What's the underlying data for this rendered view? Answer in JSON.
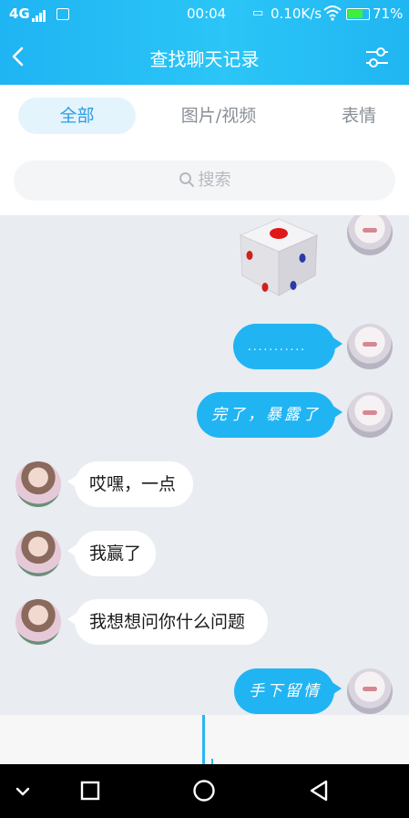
{
  "status_bar": {
    "network": "4G",
    "time": "00:04",
    "speed": "0.10K/s",
    "battery": "71%"
  },
  "header": {
    "title": "查找聊天记录"
  },
  "tabs": [
    {
      "label": "全部",
      "active": true
    },
    {
      "label": "图片/视频",
      "active": false
    },
    {
      "label": "表情",
      "active": false
    }
  ],
  "search": {
    "placeholder": "搜索"
  },
  "messages": [
    {
      "side": "out",
      "type": "dice"
    },
    {
      "side": "out",
      "type": "text",
      "text": "..........."
    },
    {
      "side": "out",
      "type": "text",
      "text": "完了，暴露了"
    },
    {
      "side": "in",
      "type": "text",
      "text": "哎嘿，一点"
    },
    {
      "side": "in",
      "type": "text",
      "text": "我赢了"
    },
    {
      "side": "in",
      "type": "text",
      "text": "我想想问你什么问题"
    },
    {
      "side": "out",
      "type": "text",
      "text": "手下留情"
    }
  ],
  "colors": {
    "accent": "#20b4f3",
    "chat_background": "#e9ecf1",
    "active_tab_background": "#e3f4fd"
  }
}
